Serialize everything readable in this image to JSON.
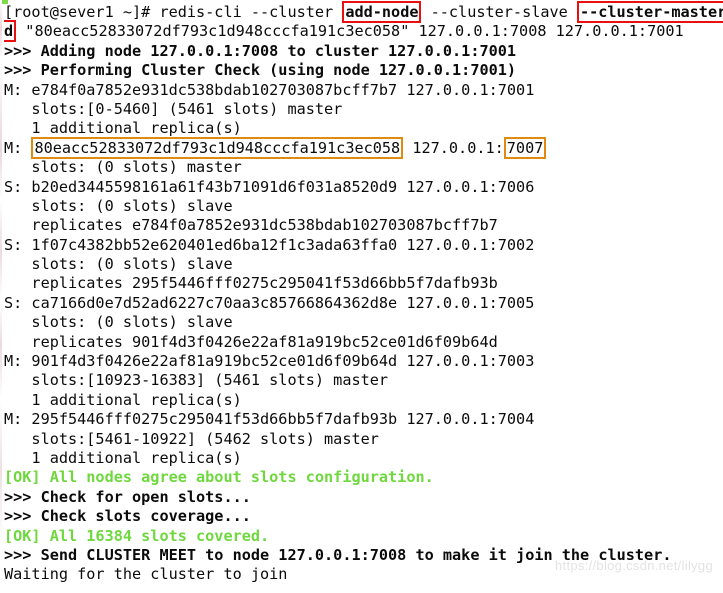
{
  "terminal": {
    "watermark": "https://blog.csdn.net/lilygg",
    "colors": {
      "background": "#ffffff",
      "foreground": "#0b0b0b",
      "ok_green": "#6fd83e",
      "highlight_red": "#e81010",
      "highlight_orange": "#e08a10"
    },
    "prompt": "[root@sever1 ~]# ",
    "lines": [
      {
        "id": "command-line-1",
        "segments": [
          {
            "text": "[root@sever1 ~]# redis-cli --cluster ",
            "style": "plain"
          },
          {
            "text": "add-node",
            "style": "box-red"
          },
          {
            "text": " --cluster-slave ",
            "style": "plain"
          },
          {
            "text": "--cluster-master-i",
            "style": "box-red-open-right"
          }
        ]
      },
      {
        "id": "command-line-2",
        "segments": [
          {
            "text": "d",
            "style": "box-red-open-left"
          },
          {
            "text": " \"80eacc52833072df793c1d948cccfa191c3ec058\" 127.0.0.1:7008 127.0.0.1:7001",
            "style": "plain"
          }
        ]
      },
      {
        "id": "adding-node",
        "text": ">>> Adding node 127.0.0.1:7008 to cluster 127.0.0.1:7001",
        "style": "bold"
      },
      {
        "id": "performing-cluster-check",
        "text": ">>> Performing Cluster Check (using node 127.0.0.1:7001)",
        "style": "bold"
      },
      {
        "id": "node-master-7001",
        "text": "M: e784f0a7852e931dc538bdab102703087bcff7b7 127.0.0.1:7001",
        "style": "plain"
      },
      {
        "id": "slots-7001",
        "text": "   slots:[0-5460] (5461 slots) master",
        "style": "plain"
      },
      {
        "id": "replicas-7001",
        "text": "   1 additional replica(s)",
        "style": "plain"
      },
      {
        "id": "node-master-7007",
        "segments": [
          {
            "text": "M: ",
            "style": "plain"
          },
          {
            "text": "80eacc52833072df793c1d948cccfa191c3ec058",
            "style": "box-orange"
          },
          {
            "text": " 127.0.0.1:",
            "style": "plain"
          },
          {
            "text": "7007",
            "style": "box-orange"
          }
        ]
      },
      {
        "id": "slots-7007",
        "text": "   slots: (0 slots) master",
        "style": "plain"
      },
      {
        "id": "node-slave-7006",
        "text": "S: b20ed3445598161a61f43b71091d6f031a8520d9 127.0.0.1:7006",
        "style": "plain"
      },
      {
        "id": "slots-7006",
        "text": "   slots: (0 slots) slave",
        "style": "plain"
      },
      {
        "id": "replicates-7006",
        "text": "   replicates e784f0a7852e931dc538bdab102703087bcff7b7",
        "style": "plain"
      },
      {
        "id": "node-slave-7002",
        "text": "S: 1f07c4382bb52e620401ed6ba12f1c3ada63ffa0 127.0.0.1:7002",
        "style": "plain"
      },
      {
        "id": "slots-7002",
        "text": "   slots: (0 slots) slave",
        "style": "plain"
      },
      {
        "id": "replicates-7002",
        "text": "   replicates 295f5446fff0275c295041f53d66bb5f7dafb93b",
        "style": "plain"
      },
      {
        "id": "node-slave-7005",
        "text": "S: ca7166d0e7d52ad6227c70aa3c85766864362d8e 127.0.0.1:7005",
        "style": "plain"
      },
      {
        "id": "slots-7005",
        "text": "   slots: (0 slots) slave",
        "style": "plain"
      },
      {
        "id": "replicates-7005",
        "text": "   replicates 901f4d3f0426e22af81a919bc52ce01d6f09b64d",
        "style": "plain"
      },
      {
        "id": "node-master-7003",
        "text": "M: 901f4d3f0426e22af81a919bc52ce01d6f09b64d 127.0.0.1:7003",
        "style": "plain"
      },
      {
        "id": "slots-7003",
        "text": "   slots:[10923-16383] (5461 slots) master",
        "style": "plain"
      },
      {
        "id": "replicas-7003",
        "text": "   1 additional replica(s)",
        "style": "plain"
      },
      {
        "id": "node-master-7004",
        "text": "M: 295f5446fff0275c295041f53d66bb5f7dafb93b 127.0.0.1:7004",
        "style": "plain"
      },
      {
        "id": "slots-7004",
        "text": "   slots:[5461-10922] (5462 slots) master",
        "style": "plain"
      },
      {
        "id": "replicas-7004",
        "text": "   1 additional replica(s)",
        "style": "plain"
      },
      {
        "id": "ok-slots-agree",
        "text": "[OK] All nodes agree about slots configuration.",
        "style": "green"
      },
      {
        "id": "check-open-slots",
        "text": ">>> Check for open slots...",
        "style": "bold"
      },
      {
        "id": "check-slots-coverage",
        "text": ">>> Check slots coverage...",
        "style": "bold"
      },
      {
        "id": "ok-slots-covered",
        "text": "[OK] All 16384 slots covered.",
        "style": "green"
      },
      {
        "id": "send-cluster-meet",
        "text": ">>> Send CLUSTER MEET to node 127.0.0.1:7008 to make it join the cluster.",
        "style": "bold"
      },
      {
        "id": "waiting-for-join",
        "text": "Waiting for the cluster to join",
        "style": "plain"
      }
    ]
  }
}
